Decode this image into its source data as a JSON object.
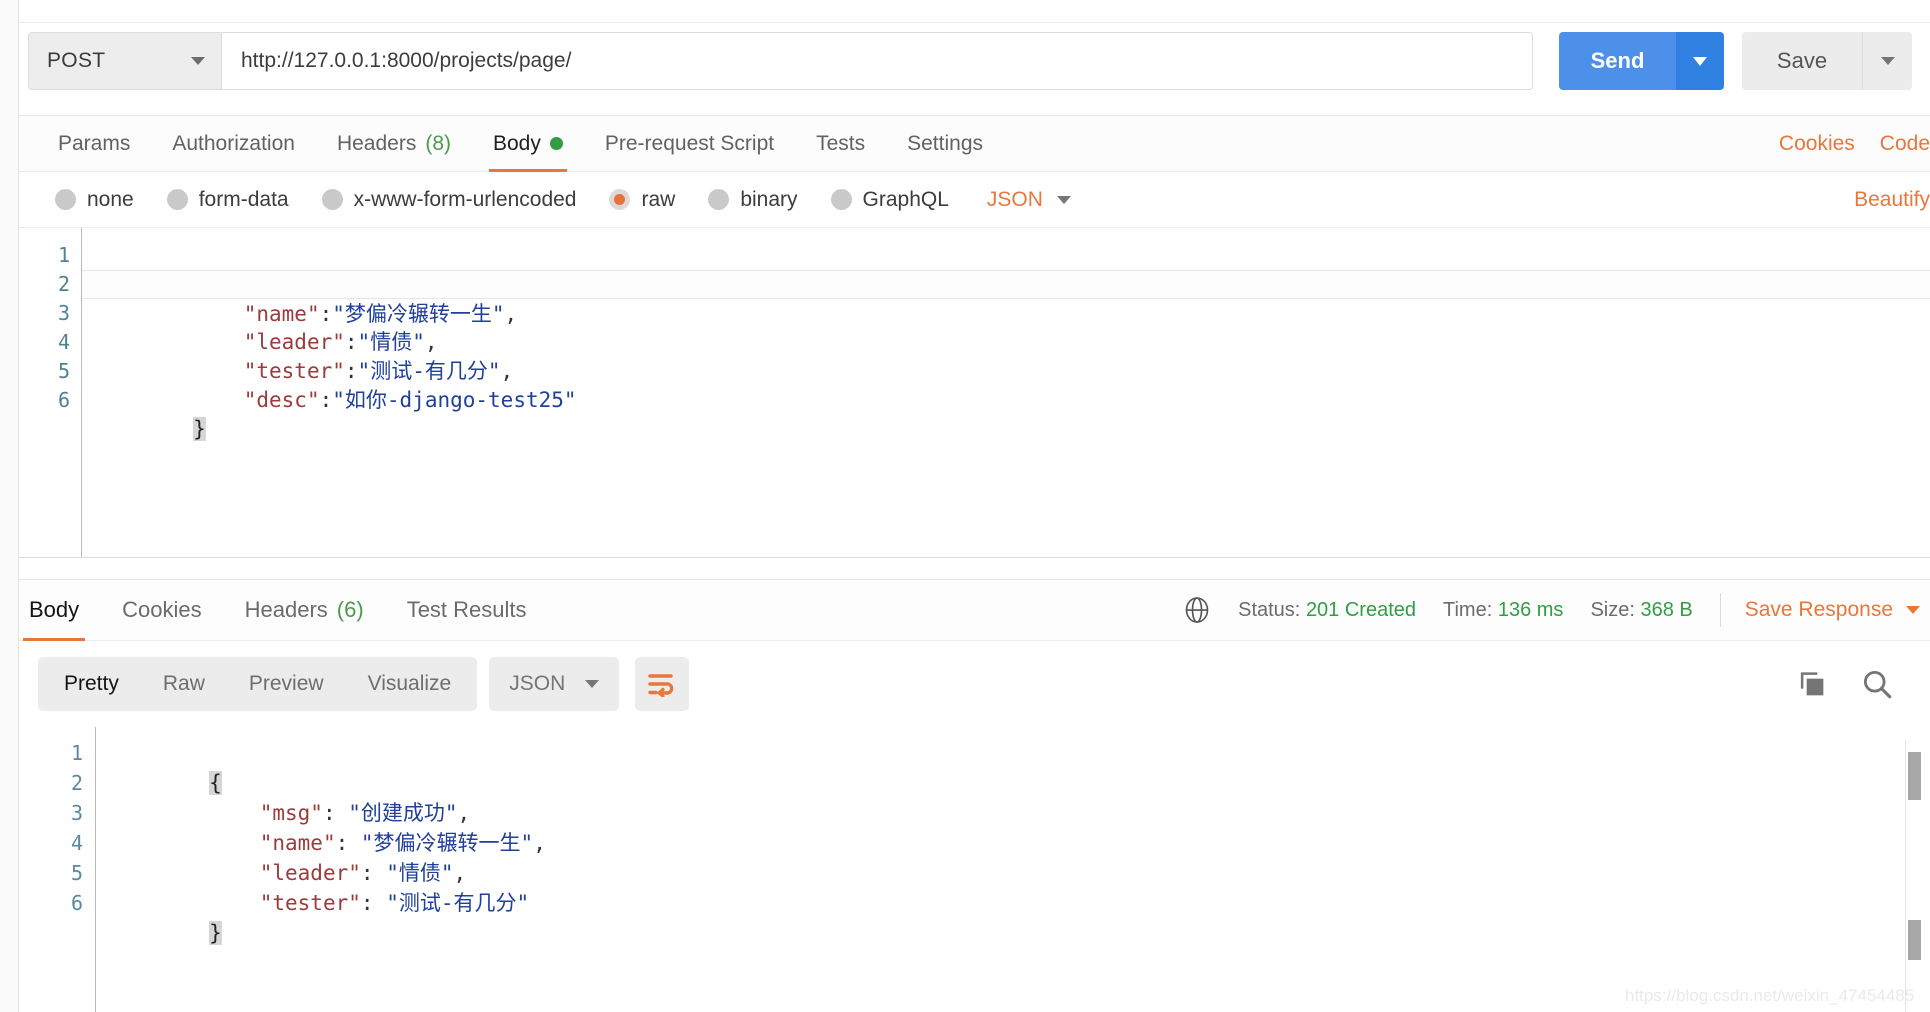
{
  "request": {
    "method": "POST",
    "url": "http://127.0.0.1:8000/projects/page/",
    "send_label": "Send",
    "save_label": "Save",
    "tabs": [
      {
        "label": "Params",
        "count": "",
        "dot": false,
        "active": false
      },
      {
        "label": "Authorization",
        "count": "",
        "dot": false,
        "active": false
      },
      {
        "label": "Headers",
        "count": "(8)",
        "dot": false,
        "active": false
      },
      {
        "label": "Body",
        "count": "",
        "dot": true,
        "active": true
      },
      {
        "label": "Pre-request Script",
        "count": "",
        "dot": false,
        "active": false
      },
      {
        "label": "Tests",
        "count": "",
        "dot": false,
        "active": false
      },
      {
        "label": "Settings",
        "count": "",
        "dot": false,
        "active": false
      }
    ],
    "tabs_right": [
      "Cookies",
      "Code"
    ],
    "body_types": [
      {
        "label": "none",
        "selected": false
      },
      {
        "label": "form-data",
        "selected": false
      },
      {
        "label": "x-www-form-urlencoded",
        "selected": false
      },
      {
        "label": "raw",
        "selected": true
      },
      {
        "label": "binary",
        "selected": false
      },
      {
        "label": "GraphQL",
        "selected": false
      }
    ],
    "raw_format": "JSON",
    "beautify_label": "Beautify",
    "editor_lines": [
      {
        "n": "1",
        "text": "{",
        "type": "brace-open",
        "highlight": false
      },
      {
        "n": "2",
        "key": "\"name\"",
        "sep": ":",
        "val": "\"梦偏冷辗转一生\"",
        "comma": ",",
        "type": "pair",
        "highlight": true
      },
      {
        "n": "3",
        "key": "\"leader\"",
        "sep": ":",
        "val": "\"情债\"",
        "comma": ",",
        "type": "pair",
        "highlight": false
      },
      {
        "n": "4",
        "key": "\"tester\"",
        "sep": ":",
        "val": "\"测试-有几分\"",
        "comma": ",",
        "type": "pair",
        "highlight": false
      },
      {
        "n": "5",
        "key": "\"desc\"",
        "sep": ":",
        "val": "\"如你-django-test25\"",
        "comma": "",
        "type": "pair",
        "highlight": false
      },
      {
        "n": "6",
        "text": "}",
        "type": "brace-close",
        "highlight": false
      }
    ]
  },
  "response": {
    "tabs": [
      {
        "label": "Body",
        "count": "",
        "active": true
      },
      {
        "label": "Cookies",
        "count": "",
        "active": false
      },
      {
        "label": "Headers",
        "count": "(6)",
        "active": false
      },
      {
        "label": "Test Results",
        "count": "",
        "active": false
      }
    ],
    "status_label": "Status:",
    "status_value": "201 Created",
    "time_label": "Time:",
    "time_value": "136 ms",
    "size_label": "Size:",
    "size_value": "368 B",
    "save_response_label": "Save Response",
    "view_modes": [
      {
        "label": "Pretty",
        "active": true
      },
      {
        "label": "Raw",
        "active": false
      },
      {
        "label": "Preview",
        "active": false
      },
      {
        "label": "Visualize",
        "active": false
      }
    ],
    "format": "JSON",
    "editor_lines": [
      {
        "n": "1",
        "text": "{",
        "type": "brace-open"
      },
      {
        "n": "2",
        "key": "\"msg\"",
        "sep": ": ",
        "val": "\"创建成功\"",
        "comma": ",",
        "type": "pair"
      },
      {
        "n": "3",
        "key": "\"name\"",
        "sep": ": ",
        "val": "\"梦偏冷辗转一生\"",
        "comma": ",",
        "type": "pair"
      },
      {
        "n": "4",
        "key": "\"leader\"",
        "sep": ": ",
        "val": "\"情债\"",
        "comma": ",",
        "type": "pair"
      },
      {
        "n": "5",
        "key": "\"tester\"",
        "sep": ": ",
        "val": "\"测试-有几分\"",
        "comma": "",
        "type": "pair"
      },
      {
        "n": "6",
        "text": "}",
        "type": "brace-close"
      }
    ]
  },
  "watermark": "https://blog.csdn.net/weixin_47454485",
  "colors": {
    "accent_orange": "#e8773c",
    "send_blue": "#4d90ea",
    "status_green": "#2f9e44",
    "json_key": "#9c3b3b",
    "json_value": "#20409a",
    "line_number": "#4e8296"
  }
}
